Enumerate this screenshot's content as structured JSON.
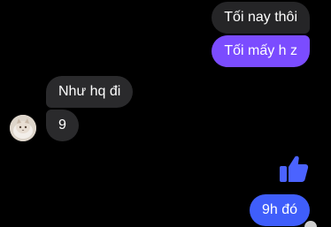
{
  "messages": [
    {
      "id": "m1",
      "direction": "outgoing",
      "text": "Tối nay thôi"
    },
    {
      "id": "m2",
      "direction": "outgoing",
      "text": "Tối mấy h z"
    },
    {
      "id": "m3",
      "direction": "incoming",
      "text": "Như hq đi"
    },
    {
      "id": "m4",
      "direction": "incoming",
      "text": "9"
    },
    {
      "id": "m5",
      "direction": "outgoing",
      "type": "like"
    },
    {
      "id": "m6",
      "direction": "outgoing",
      "text": "9h đó"
    }
  ],
  "icons": {
    "like": "thumbs-up-icon",
    "avatar": "contact-avatar",
    "read_receipt": "read-receipt-avatar"
  },
  "colors": {
    "background": "#000000",
    "incoming_bubble": "#2a2a2c",
    "outgoing_bubble_gray": "#252527",
    "outgoing_bubble_purple": "#7b4cff",
    "outgoing_bubble_blue": "#3f5efb",
    "like_icon": "#4b63ff",
    "text": "#ffffff"
  }
}
